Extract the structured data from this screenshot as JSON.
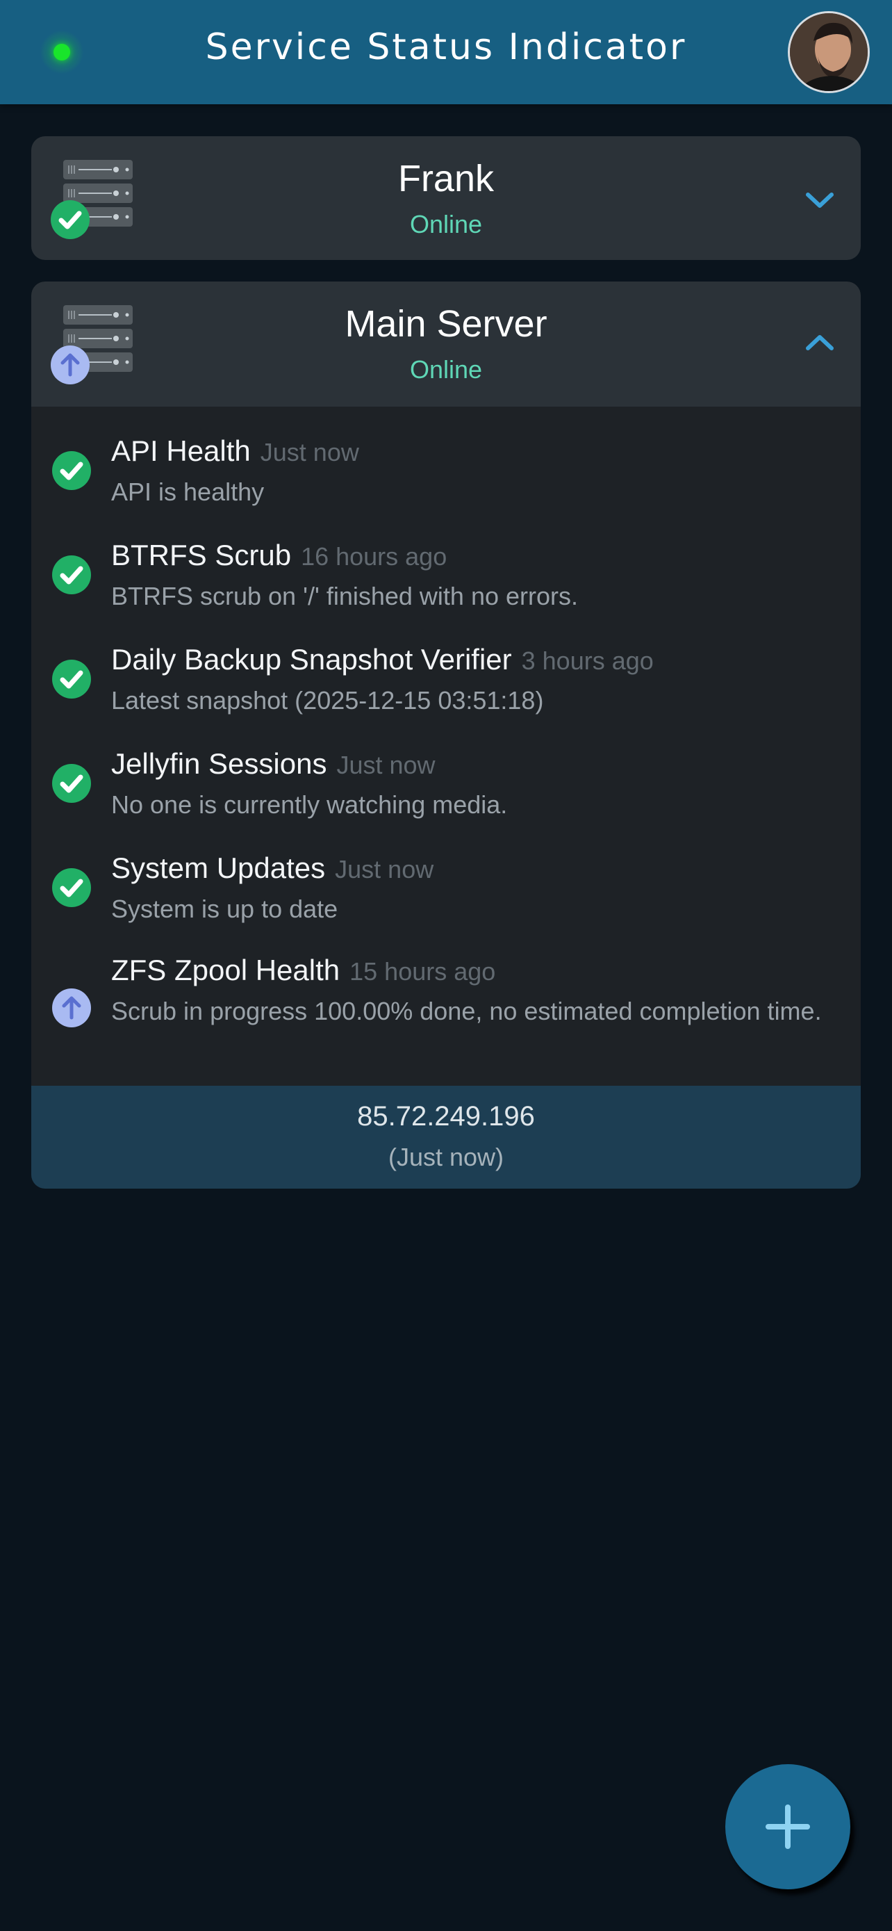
{
  "header": {
    "title": "Service Status Indicator",
    "status_color": "#19e52b"
  },
  "servers": [
    {
      "name": "Frank",
      "status": "Online",
      "badge": "check-icon",
      "expanded": false
    },
    {
      "name": "Main Server",
      "status": "Online",
      "badge": "arrow-up-icon",
      "expanded": true,
      "checks": [
        {
          "title": "API Health",
          "time": "Just now",
          "description": "API is healthy",
          "state": "ok"
        },
        {
          "title": "BTRFS Scrub",
          "time": "16 hours ago",
          "description": "BTRFS scrub on '/' finished with no errors.",
          "state": "ok"
        },
        {
          "title": "Daily Backup Snapshot Verifier",
          "time": "3 hours ago",
          "description": "Latest snapshot (2025-12-15 03:51:18)",
          "state": "ok"
        },
        {
          "title": "Jellyfin Sessions",
          "time": "Just now",
          "description": "No one is currently watching media.",
          "state": "ok"
        },
        {
          "title": "System Updates",
          "time": "Just now",
          "description": "System is up to date",
          "state": "ok"
        },
        {
          "title": "ZFS Zpool Health",
          "time": "15 hours ago",
          "description": "Scrub in progress 100.00% done, no estimated completion time.",
          "state": "in-progress"
        }
      ],
      "footer": {
        "ip": "85.72.249.196",
        "updated": "(Just now)"
      }
    }
  ],
  "colors": {
    "ok": "#21b066",
    "in_progress": "#a9baf2",
    "accent": "#3aa0d8",
    "online": "#5fd7b6"
  }
}
